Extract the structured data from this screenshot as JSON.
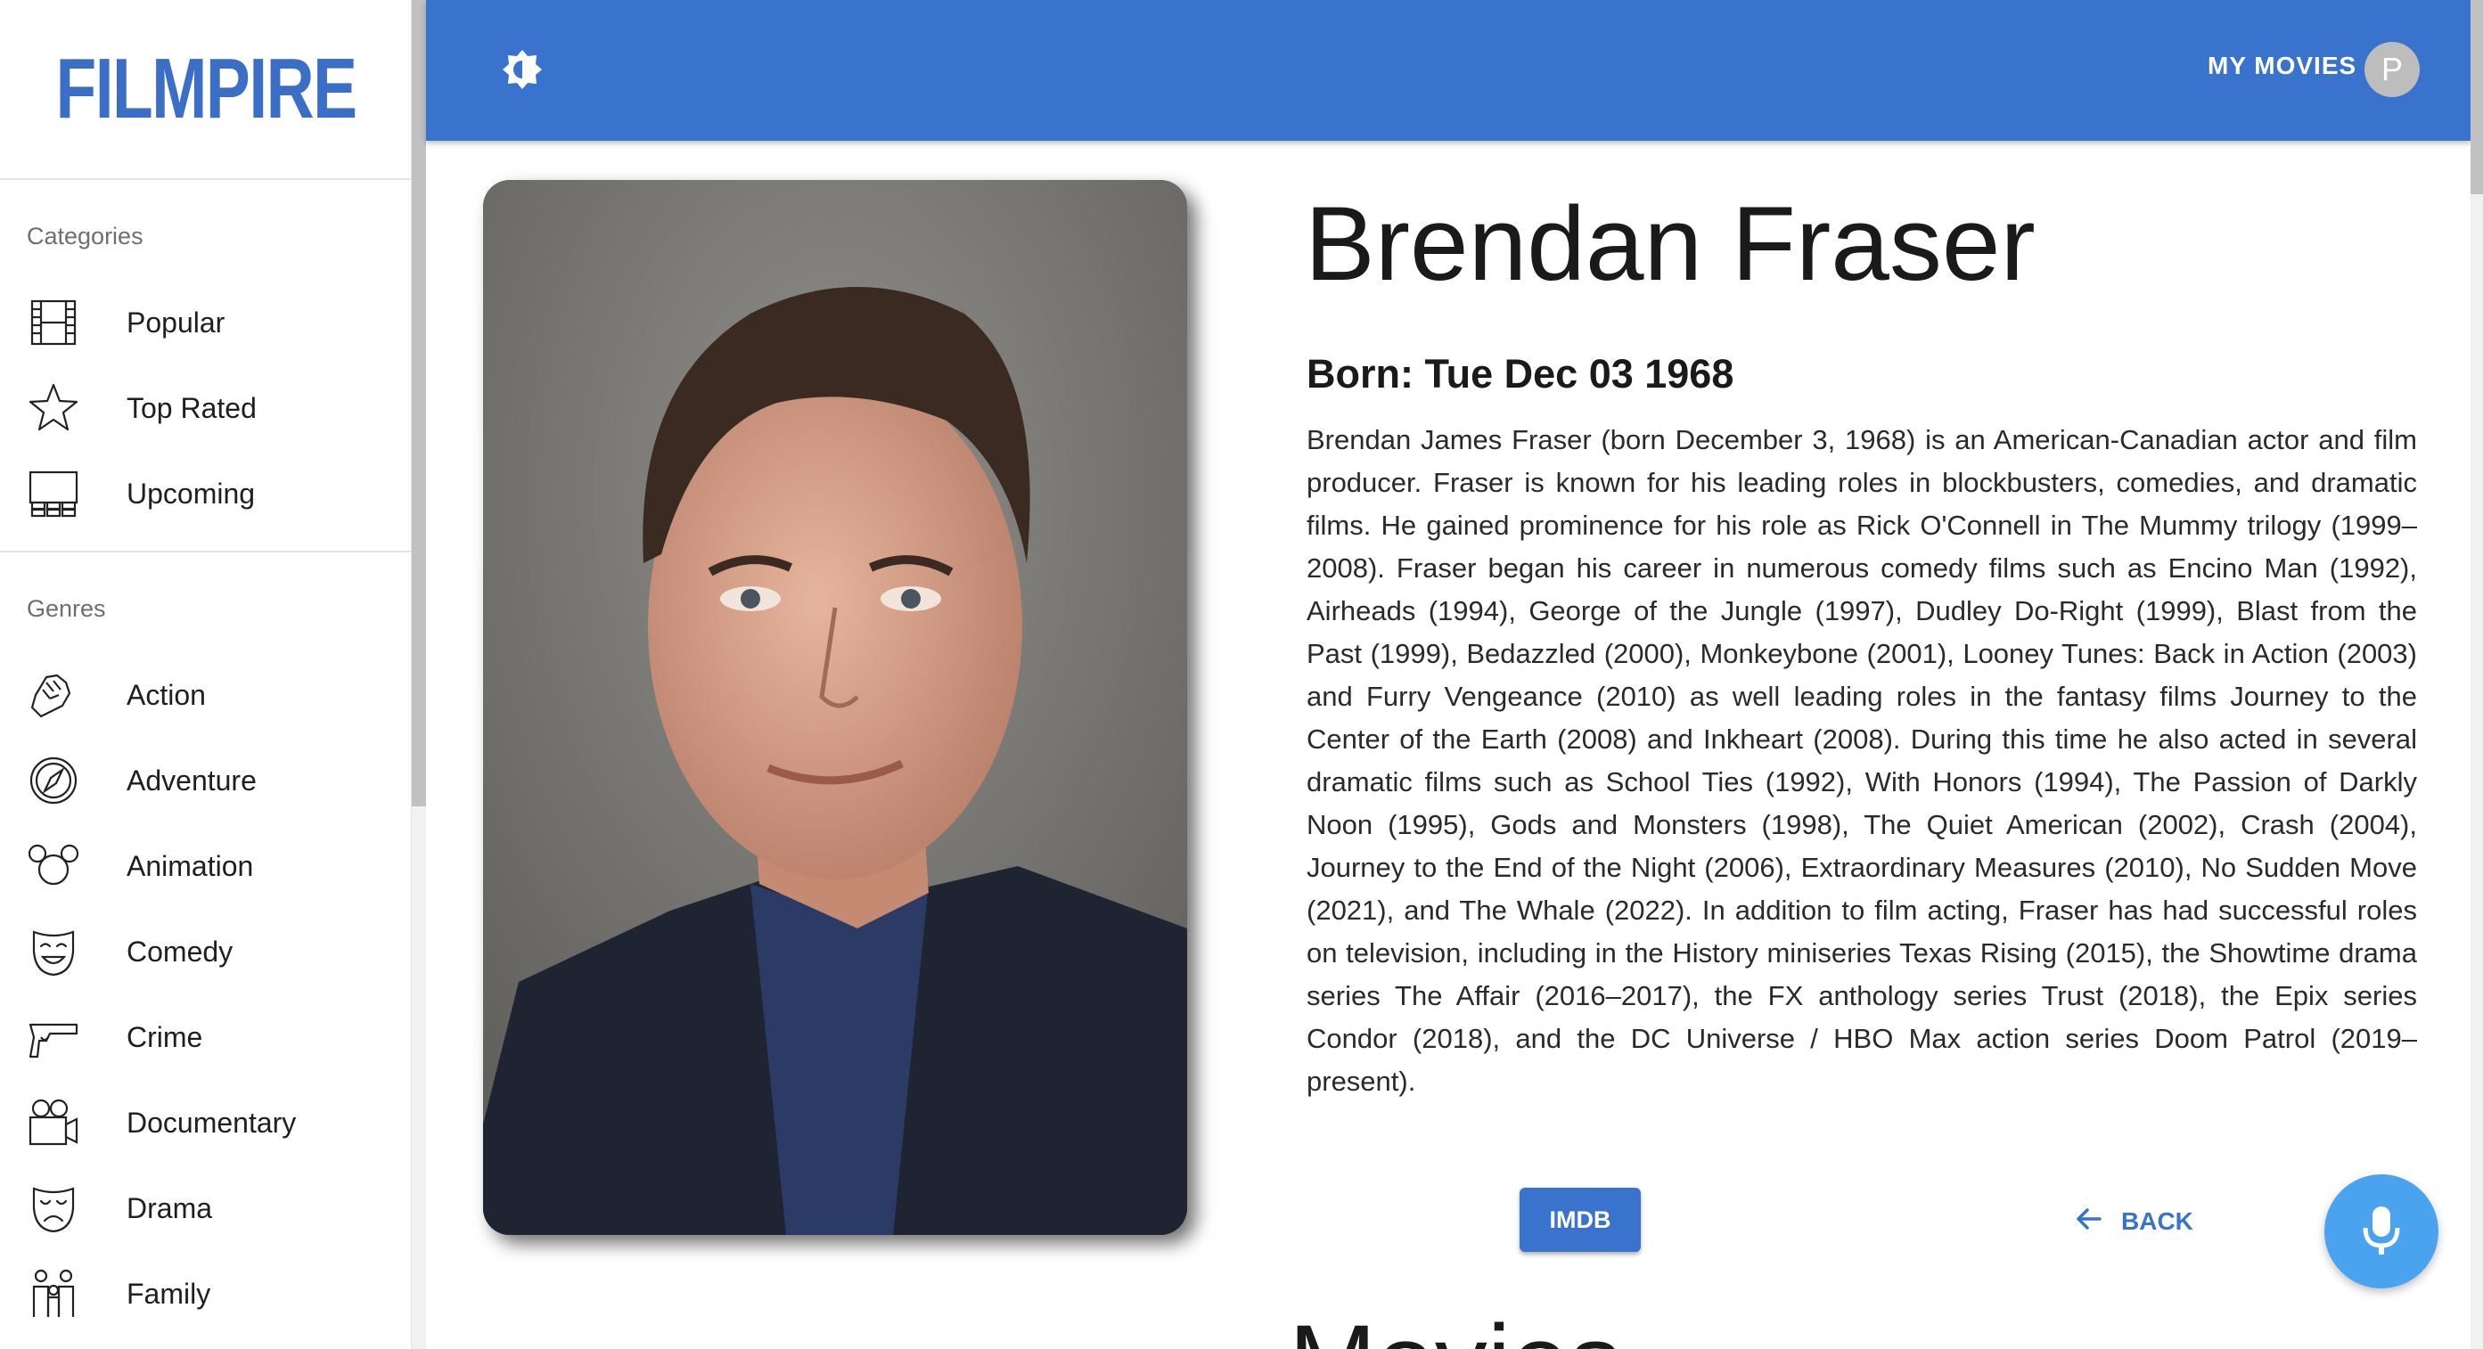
{
  "sidebar": {
    "logo": "FILMPIRE",
    "categories_title": "Categories",
    "categories": [
      {
        "label": "Popular",
        "icon": "film-strip-icon"
      },
      {
        "label": "Top Rated",
        "icon": "star-icon"
      },
      {
        "label": "Upcoming",
        "icon": "cinema-seats-icon"
      }
    ],
    "genres_title": "Genres",
    "genres": [
      {
        "label": "Action",
        "icon": "fist-icon"
      },
      {
        "label": "Adventure",
        "icon": "compass-icon"
      },
      {
        "label": "Animation",
        "icon": "mouse-ears-icon"
      },
      {
        "label": "Comedy",
        "icon": "comedy-mask-icon"
      },
      {
        "label": "Crime",
        "icon": "pistol-icon"
      },
      {
        "label": "Documentary",
        "icon": "movie-camera-icon"
      },
      {
        "label": "Drama",
        "icon": "drama-mask-icon"
      },
      {
        "label": "Family",
        "icon": "family-icon"
      }
    ]
  },
  "topbar": {
    "theme_icon": "brightness-icon",
    "my_movies": "MY MOVIES",
    "avatar_letter": "P"
  },
  "person": {
    "name": "Brendan Fraser",
    "born": "Born: Tue Dec 03 1968",
    "bio": "Brendan James Fraser (born December 3, 1968) is an American-Canadian actor and film producer. Fraser is known for his leading roles in blockbusters, comedies, and dramatic films. He gained prominence for his role as Rick O'Connell in The Mummy trilogy (1999–2008). Fraser began his career in numerous comedy films such as Encino Man (1992), Airheads (1994), George of the Jungle (1997), Dudley Do-Right (1999), Blast from the Past (1999), Bedazzled (2000), Monkeybone (2001), Looney Tunes: Back in Action (2003) and Furry Vengeance (2010) as well leading roles in the fantasy films Journey to the Center of the Earth (2008) and Inkheart (2008). During this time he also acted in several dramatic films such as School Ties (1992), With Honors (1994), The Passion of Darkly Noon (1995), Gods and Monsters (1998), The Quiet American (2002), Crash (2004), Journey to the End of the Night (2006), Extraordinary Measures (2010), No Sudden Move (2021), and The Whale (2022). In addition to film acting, Fraser has had successful roles on television, including in the History miniseries Texas Rising (2015), the Showtime drama series The Affair (2016–2017), the FX anthology series Trust (2018), the Epix series Condor (2018), and the DC Universe / HBO Max action series Doom Patrol (2019–present)."
  },
  "actions": {
    "imdb": "IMDB",
    "back": "BACK"
  },
  "movies_heading": "Movies",
  "colors": {
    "primary": "#3a73ce",
    "mic": "#4aa3ef"
  }
}
